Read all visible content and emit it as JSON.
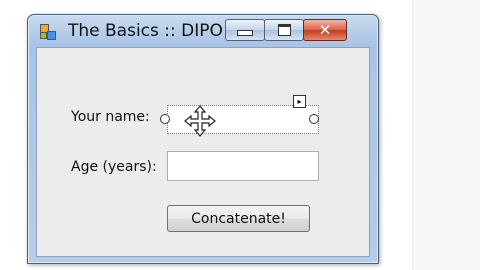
{
  "window": {
    "title": "The Basics :: DIPO"
  },
  "form": {
    "name_label": "Your name:",
    "name_value": "",
    "age_label": "Age (years):",
    "age_value": "",
    "button_label": "Concatenate!"
  },
  "colors": {
    "titlebar": "#b6cde8",
    "client": "#ececec",
    "close": "#c63a1f"
  },
  "icons": [
    "app-icon",
    "minimize-icon",
    "maximize-icon",
    "close-icon",
    "move-cursor-icon",
    "smart-tag-icon"
  ]
}
